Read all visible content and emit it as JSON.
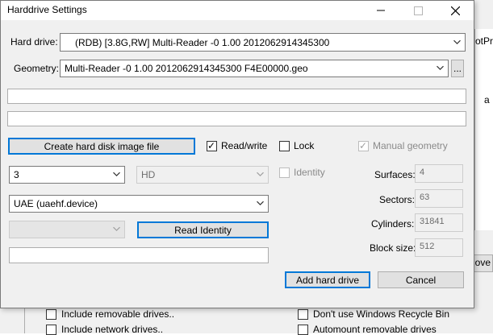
{
  "dialog": {
    "title": "Harddrive Settings",
    "controls": {
      "minimize_icon": "minimize-icon",
      "maximize_icon": "maximize-icon",
      "close_icon": "close-icon"
    },
    "hard_drive": {
      "label": "Hard drive:",
      "value": "(RDB) [3.8G,RW] Multi-Reader  -0 1.00 2012062914345300"
    },
    "geometry": {
      "label": "Geometry:",
      "value": "Multi-Reader  -0 1.00 2012062914345300 F4E00000.geo",
      "browse_label": "..."
    },
    "buttons": {
      "create_image": "Create hard disk image file",
      "read_identity": "Read Identity",
      "add_hard_drive": "Add hard drive",
      "cancel": "Cancel"
    },
    "checkboxes": {
      "read_write": {
        "label": "Read/write",
        "checked": true
      },
      "lock": {
        "label": "Lock",
        "checked": false
      },
      "manual_geometry": {
        "label": "Manual geometry",
        "checked": true,
        "enabled": false
      },
      "identity": {
        "label": "Identity",
        "checked": false,
        "enabled": false
      }
    },
    "combos": {
      "unit": "3",
      "mode": "HD",
      "controller": "UAE (uaehf.device)",
      "subunit": ""
    },
    "geometry_fields": {
      "surfaces": {
        "label": "Surfaces:",
        "value": "4"
      },
      "sectors": {
        "label": "Sectors:",
        "value": "63"
      },
      "cylinders": {
        "label": "Cylinders:",
        "value": "31841"
      },
      "block_size": {
        "label": "Block size:",
        "value": "512"
      }
    }
  },
  "background": {
    "fragment_top_right": "otPri",
    "fragment_a": "a",
    "fragment_button": "ove",
    "checks": {
      "include_removable": "Include removable drives..",
      "include_network": "Include network drives..",
      "dont_use_recycle": "Don't use Windows Recycle Bin",
      "automount_removable": "Automount removable drives"
    }
  },
  "colors": {
    "accent": "#0078d7",
    "dialog_bg": "#f0f0f0"
  }
}
